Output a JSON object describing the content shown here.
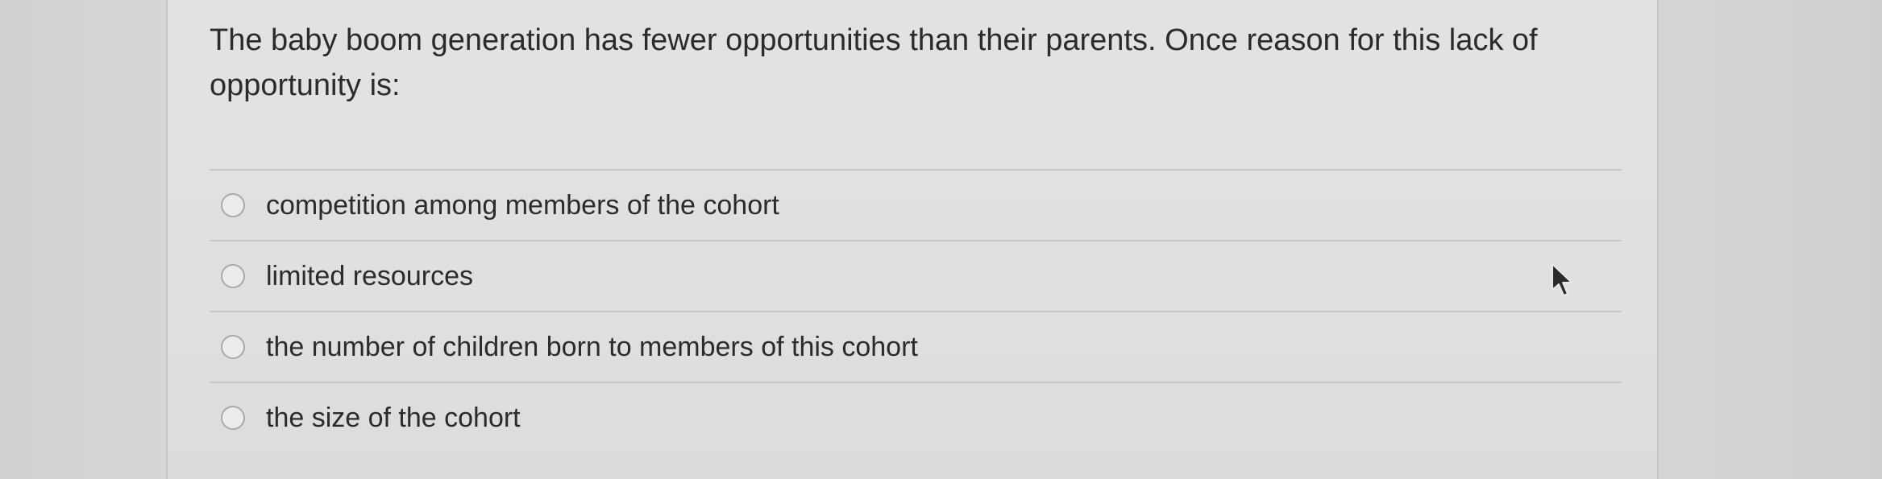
{
  "question": {
    "text": "The baby boom generation has fewer opportunities than their parents.  Once reason for this lack of opportunity is:"
  },
  "answers": [
    {
      "label": "competition among members of the cohort",
      "selected": false
    },
    {
      "label": "limited resources",
      "selected": false
    },
    {
      "label": "the number of children born to members of this cohort",
      "selected": false
    },
    {
      "label": "the size of the cohort",
      "selected": false
    }
  ],
  "icons": {
    "radio": "radio-unchecked-icon",
    "cursor": "mouse-pointer-icon"
  },
  "colors": {
    "text": "#2b2b2b",
    "divider": "#c7c7c5",
    "radio_border": "#a9a9a7"
  }
}
